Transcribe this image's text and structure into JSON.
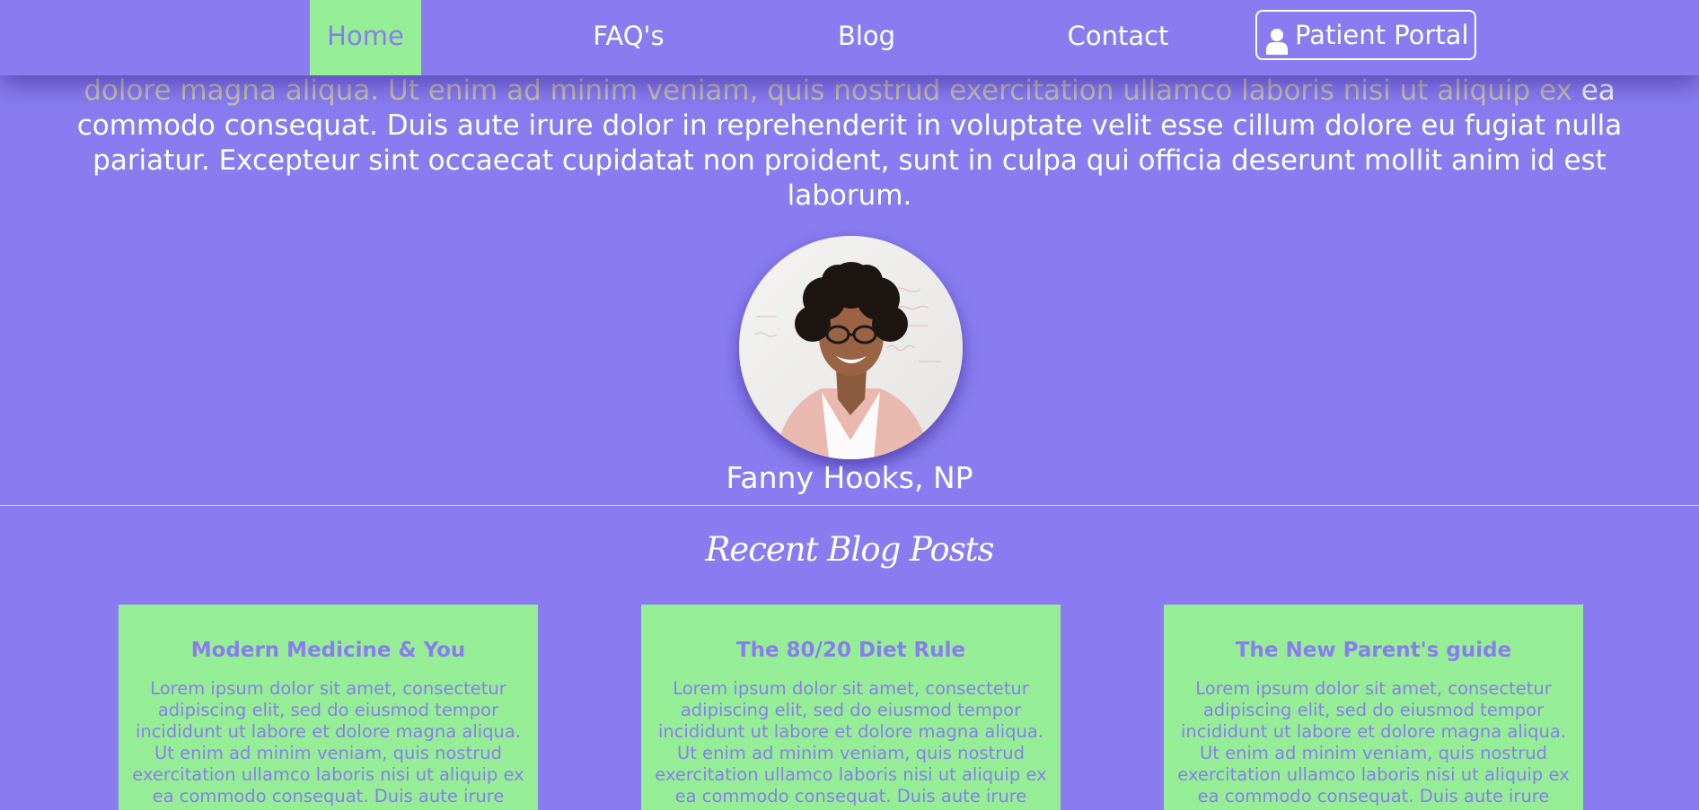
{
  "nav": {
    "items": [
      {
        "label": "Home",
        "active": true
      },
      {
        "label": "FAQ's",
        "active": false
      },
      {
        "label": "Blog",
        "active": false
      },
      {
        "label": "Contact",
        "active": false
      }
    ],
    "portal_label": "Patient Portal",
    "portal_icon": "user-icon"
  },
  "intro": {
    "partial_line": "dolore magna aliqua. Ut enim ad minim veniam, quis nostrud exercitation ullamco laboris nisi ut aliquip ex",
    "text": "ea commodo consequat. Duis aute irure dolor in reprehenderit in voluptate velit esse cillum dolore eu fugiat nulla pariatur. Excepteur sint occaecat cupidatat non proident, sunt in culpa qui officia deserunt mollit anim id est laborum."
  },
  "profile": {
    "name": "Fanny Hooks, NP"
  },
  "blog": {
    "heading": "Recent Blog Posts",
    "posts": [
      {
        "title": "Modern Medicine & You",
        "excerpt": "Lorem ipsum dolor sit amet, consectetur adipiscing elit, sed do eiusmod tempor incididunt ut labore et dolore magna aliqua. Ut enim ad minim veniam, quis nostrud exercitation ullamco laboris nisi ut aliquip ex ea commodo consequat. Duis aute irure"
      },
      {
        "title": "The 80/20 Diet Rule",
        "excerpt": "Lorem ipsum dolor sit amet, consectetur adipiscing elit, sed do eiusmod tempor incididunt ut labore et dolore magna aliqua. Ut enim ad minim veniam, quis nostrud exercitation ullamco laboris nisi ut aliquip ex ea commodo consequat. Duis aute irure"
      },
      {
        "title": "The New Parent's guide",
        "excerpt": "Lorem ipsum dolor sit amet, consectetur adipiscing elit, sed do eiusmod tempor incididunt ut labore et dolore magna aliqua. Ut enim ad minim veniam, quis nostrud exercitation ullamco laboris nisi ut aliquip ex ea commodo consequat. Duis aute irure"
      }
    ]
  },
  "colors": {
    "background": "#8a7cf0",
    "accent": "#95ee95",
    "text": "#ffffff"
  }
}
